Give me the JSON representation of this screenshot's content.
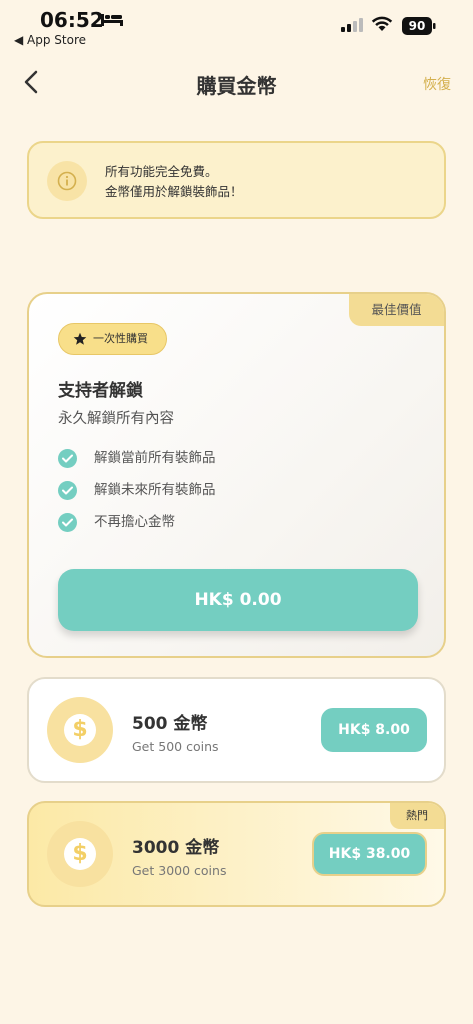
{
  "status_bar": {
    "time": "06:52",
    "back_app": "◀ App Store",
    "battery": "90"
  },
  "nav": {
    "title": "購買金幣",
    "restore": "恢復"
  },
  "info": {
    "line1": "所有功能完全免費。",
    "line2": "金幣僅用於解鎖裝飾品！"
  },
  "best_card": {
    "ribbon": "最佳價值",
    "badge": "一次性購買",
    "title": "支持者解鎖",
    "subtitle": "永久解鎖所有內容",
    "features": [
      "解鎖當前所有裝飾品",
      "解鎖未來所有裝飾品",
      "不再擔心金幣"
    ],
    "price": "HK$ 0.00"
  },
  "coin_500": {
    "name": "500 金幣",
    "sub": "Get 500 coins",
    "price": "HK$ 8.00"
  },
  "coin_3000": {
    "ribbon": "熱門",
    "name": "3000 金幣",
    "sub": "Get 3000 coins",
    "price": "HK$ 38.00"
  },
  "colors": {
    "background": "#FDF5E6",
    "accent_teal": "#74CEC1",
    "accent_gold": "#F3DC94"
  }
}
